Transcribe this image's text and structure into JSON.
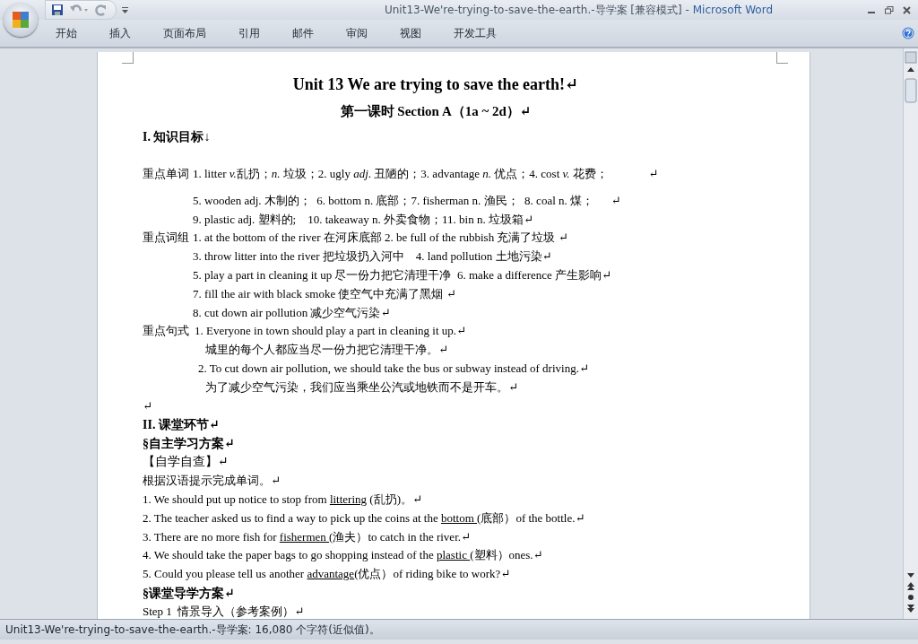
{
  "window": {
    "document_title": "Unit13-We're-trying-to-save-the-earth.-导学案 [兼容模式]",
    "separator": "-",
    "app_name": "Microsoft Word"
  },
  "tabs": [
    {
      "label": "开始",
      "selected": false
    },
    {
      "label": "插入",
      "selected": false
    },
    {
      "label": "页面布局",
      "selected": false
    },
    {
      "label": "引用",
      "selected": false
    },
    {
      "label": "邮件",
      "selected": false
    },
    {
      "label": "审阅",
      "selected": false
    },
    {
      "label": "视图",
      "selected": false
    },
    {
      "label": "开发工具",
      "selected": false
    }
  ],
  "document": {
    "title": "Unit 13 We are trying to save the earth!↵",
    "subtitle": "第一课时  Section A（1a ~ 2d）↵",
    "section_1": "I. 知识目标↓",
    "vocabulary": {
      "label": "重点单词",
      "first_line": [
        {
          "text": "1. litter ",
          "italic": false
        },
        {
          "text": "v.",
          "italic": true
        },
        {
          "text": "乱扔；",
          "italic": false
        },
        {
          "text": "n.",
          "italic": true
        },
        {
          "text": " 垃圾；2. ugly ",
          "italic": false
        },
        {
          "text": "adj",
          "italic": true
        },
        {
          "text": ". 丑陋的；3. advantage ",
          "italic": false
        },
        {
          "text": "n.",
          "italic": true
        },
        {
          "text": " 优点；4. cost ",
          "italic": false
        },
        {
          "text": "v.",
          "italic": true
        },
        {
          "text": " 花费；              ↵",
          "italic": false
        }
      ],
      "lines": [
        "5. wooden adj. 木制的；  6. bottom n. 底部；7. fisherman n. 渔民；  8. coal n. 煤；      ↵",
        "9. plastic adj. 塑料的;    10. takeaway n. 外卖食物；11. bin n. 垃圾箱↵"
      ]
    },
    "phrases": {
      "label": "重点词组",
      "lines": [
        "1. at the bottom of the river 在河床底部 2. be full of the rubbish 充满了垃圾 ↵",
        "3. throw litter into the river 把垃圾扔入河中    4. land pollution 土地污染↵",
        "5. play a part in cleaning it up 尽一份力把它清理干净  6. make a difference 产生影响↵",
        "7. fill the air with black smoke 使空气中充满了黑烟 ↵",
        "8. cut down air pollution 减少空气污染↵"
      ]
    },
    "sentences": {
      "label": "重点句式",
      "items": [
        {
          "english": "1. Everyone in town should play a part in cleaning it up.↵",
          "chinese": "城里的每个人都应当尽一份力把它清理干净。↵"
        },
        {
          "english": "2. To cut down air pollution, we should take the bus or subway instead of driving.↵",
          "chinese": "为了减少空气污染，我们应当乘坐公汽或地铁而不是开车。↵"
        }
      ]
    },
    "empty_paragraph": "↵",
    "section_2": "II. 课堂环节↵",
    "subsection_1": "§自主学习方案↵",
    "bracket_heading": "【自学自查】↵",
    "instruction": "根据汉语提示完成单词。↵",
    "exercises": [
      {
        "before": "1. We should put up notice to stop from ",
        "answer": "littering",
        "after": " (乱扔)。↵"
      },
      {
        "before": "2. The teacher asked us to find a way to pick up the coins at the ",
        "answer": "bottom ",
        "after": "(底部）of the bottle.↵"
      },
      {
        "before": "3. There are no more fish for ",
        "answer": "fishermen ",
        "after": "(渔夫）to catch in the river.↵"
      },
      {
        "before": "4. We should take the paper bags to go shopping instead of the ",
        "answer": "plastic ",
        "after": "(塑料）ones.↵"
      },
      {
        "before": "5. Could you please tell us another ",
        "answer": "advantage",
        "after": "(优点）of riding bike to work?↵"
      }
    ],
    "subsection_2": "§课堂导学方案↵",
    "step": "Step 1  情景导入（参考案例）↵"
  },
  "status_bar": {
    "text": "Unit13-We're-trying-to-save-the-earth.-导学案: 16,080 个字符(近似值)。"
  }
}
